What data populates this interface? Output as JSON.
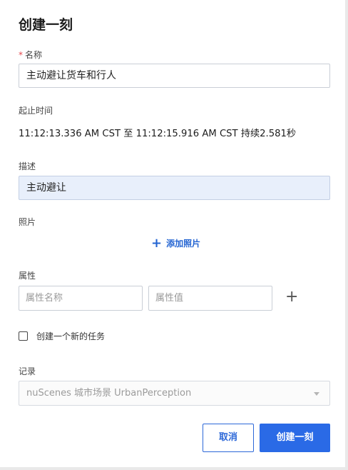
{
  "dialog": {
    "title": "创建一刻",
    "name_label": "名称",
    "required_mark": "*",
    "name_value": "主动避让货车和行人",
    "time_label": "起止时间",
    "time_value": "11:12:13.336 AM CST 至 11:12:15.916 AM CST 持续2.581秒",
    "desc_label": "描述",
    "desc_value": "主动避让",
    "photo_label": "照片",
    "add_photo": "添加照片",
    "attr_label": "属性",
    "attr_name_placeholder": "属性名称",
    "attr_value_placeholder": "属性值",
    "attr_add": "+",
    "new_task_label": "创建一个新的任务",
    "record_label": "记录",
    "record_value": "nuScenes 城市场景 UrbanPerception",
    "cancel": "取消",
    "submit": "创建一刻"
  },
  "colors": {
    "accent": "#2a6ae6",
    "required": "#e5484d",
    "filled_bg": "#e8effb"
  },
  "icons": {
    "add_photo": "plus-icon",
    "attr_add": "plus-icon",
    "select": "caret-down-icon"
  }
}
